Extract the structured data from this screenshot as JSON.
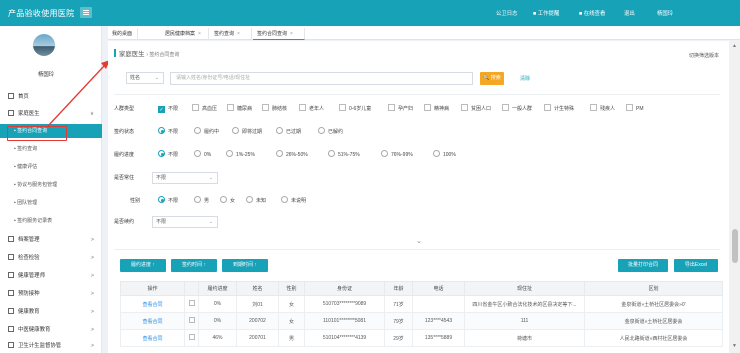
{
  "app": {
    "title": "产品验收使用医院"
  },
  "topnav": [
    {
      "label": "公卫日志"
    },
    {
      "label": "工作提醒"
    },
    {
      "label": "在线查看"
    },
    {
      "label": "退出"
    },
    {
      "label": "杨国玲"
    }
  ],
  "sidebar": {
    "user": "杨国玲",
    "items": [
      {
        "label": "首页"
      },
      {
        "label": "家庭医生",
        "arrow": "∨"
      },
      {
        "label": "签约合同查询"
      },
      {
        "label": "签约查询"
      },
      {
        "label": "健康评估"
      },
      {
        "label": "协议与服务包管理"
      },
      {
        "label": "团队管理"
      },
      {
        "label": "签约服务记录表"
      },
      {
        "label": "档案管理",
        "arrow": ">"
      },
      {
        "label": "检查检验",
        "arrow": ">"
      },
      {
        "label": "健康管理师",
        "arrow": ">"
      },
      {
        "label": "预防接种",
        "arrow": ">"
      },
      {
        "label": "健康教育",
        "arrow": ">"
      },
      {
        "label": "中医健康教育",
        "arrow": ">"
      },
      {
        "label": "卫生计生监督协管",
        "arrow": ">"
      }
    ]
  },
  "tabs": [
    {
      "label": "我的桌面"
    },
    {
      "label": "居民健康档案"
    },
    {
      "label": "签约查询"
    },
    {
      "label": "签约合同查询"
    }
  ],
  "breadcrumb": {
    "main": "家庭医生",
    "sub": "› 签约合同查询"
  },
  "switch_label": "切换筛选版本",
  "search": {
    "field": "姓名",
    "placeholder": "请输入姓名/身份证号/电话/现住址",
    "button": "搜索",
    "clear": "清除"
  },
  "filters": {
    "crowd": {
      "label": "人群类型",
      "options": [
        "不限",
        "高血压",
        "糖尿病",
        "肺结核",
        "老年人",
        "0-6岁儿童",
        "孕产妇",
        "精神病",
        "贫困人口",
        "一般人群",
        "计生特殊",
        "残疾人",
        "PM"
      ]
    },
    "status": {
      "label": "签约状态",
      "options": [
        "不限",
        "履约中",
        "即将过期",
        "已过期",
        "已解约"
      ]
    },
    "progress": {
      "label": "履约进度",
      "options": [
        "不限",
        "0%",
        "1%-25%",
        "26%-50%",
        "51%-75%",
        "76%-99%",
        "100%"
      ]
    },
    "resident": {
      "label": "是否常住",
      "value": "不限"
    },
    "gender": {
      "label": "性别",
      "options": [
        "不限",
        "男",
        "女",
        "未知",
        "未说明"
      ]
    },
    "renew": {
      "label": "是否续约",
      "value": "不限"
    }
  },
  "toolbar": {
    "b1": "履约进度 ↑",
    "b2": "签约时间 ↑",
    "b3": "到期时间 ↑",
    "b4": "批量打印合同",
    "b5": "导出Excel"
  },
  "table": {
    "headers": [
      "操作",
      "",
      "履约进度",
      "姓名",
      "性别",
      "身份证",
      "年龄",
      "电话",
      "现住址",
      "区划"
    ],
    "rows": [
      [
        "查看合同",
        "",
        "0%",
        "刘01",
        "女",
        "510703********9089",
        "71岁",
        "",
        "四川省金牛区小致合法化技术的区县决定等下...",
        "金泉街道»土桥社区居委会»0'"
      ],
      [
        "查看合同",
        "",
        "0%",
        "200702",
        "女",
        "110101********5081",
        "79岁",
        "123****4543",
        "111",
        "金泉街道»土桥社区居委会"
      ],
      [
        "查看合同",
        "",
        "46%",
        "200701",
        "男",
        "510104********4139",
        "29岁",
        "135****5889",
        "荷塘市",
        "人民北路街道»西村社区居委会"
      ]
    ]
  }
}
